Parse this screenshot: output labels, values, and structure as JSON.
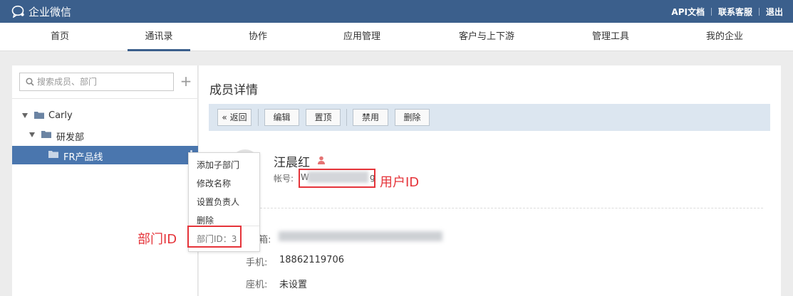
{
  "app": {
    "title": "企业微信",
    "top_links": [
      "API文档",
      "联系客服",
      "退出"
    ]
  },
  "nav": {
    "items": [
      "首页",
      "通讯录",
      "协作",
      "应用管理",
      "客户与上下游",
      "管理工具",
      "我的企业"
    ],
    "active": "通讯录"
  },
  "sidebar": {
    "search_placeholder": "搜索成员、部门",
    "tree": [
      {
        "label": "Carly",
        "expanded": true
      },
      {
        "label": "研发部",
        "expanded": true
      },
      {
        "label": "FR产品线",
        "selected": true
      }
    ]
  },
  "context_menu": {
    "items": [
      "添加子部门",
      "修改名称",
      "设置负责人",
      "删除"
    ],
    "dept_id_label": "部门ID：3"
  },
  "detail": {
    "title": "成员详情",
    "toolbar": {
      "back": "返回",
      "edit": "编辑",
      "pin": "置顶",
      "disable": "禁用",
      "delete": "删除"
    },
    "name": "汪晨红",
    "account_label": "帐号:",
    "account_prefix": "W",
    "account_suffix": "g",
    "fields": {
      "email_label": "箱:",
      "mobile_label": "手机:",
      "mobile_value": "18862119706",
      "landline_label": "座机:",
      "landline_value": "未设置"
    }
  },
  "annotations": {
    "user_id": "用户ID",
    "dept_id": "部门ID"
  },
  "colors": {
    "topbar": "#3b5f8c",
    "selected_row": "#4a76ae",
    "toolbar_bg": "#dce6f0",
    "annotation": "#e5343a",
    "person_icon": "#e57373"
  }
}
